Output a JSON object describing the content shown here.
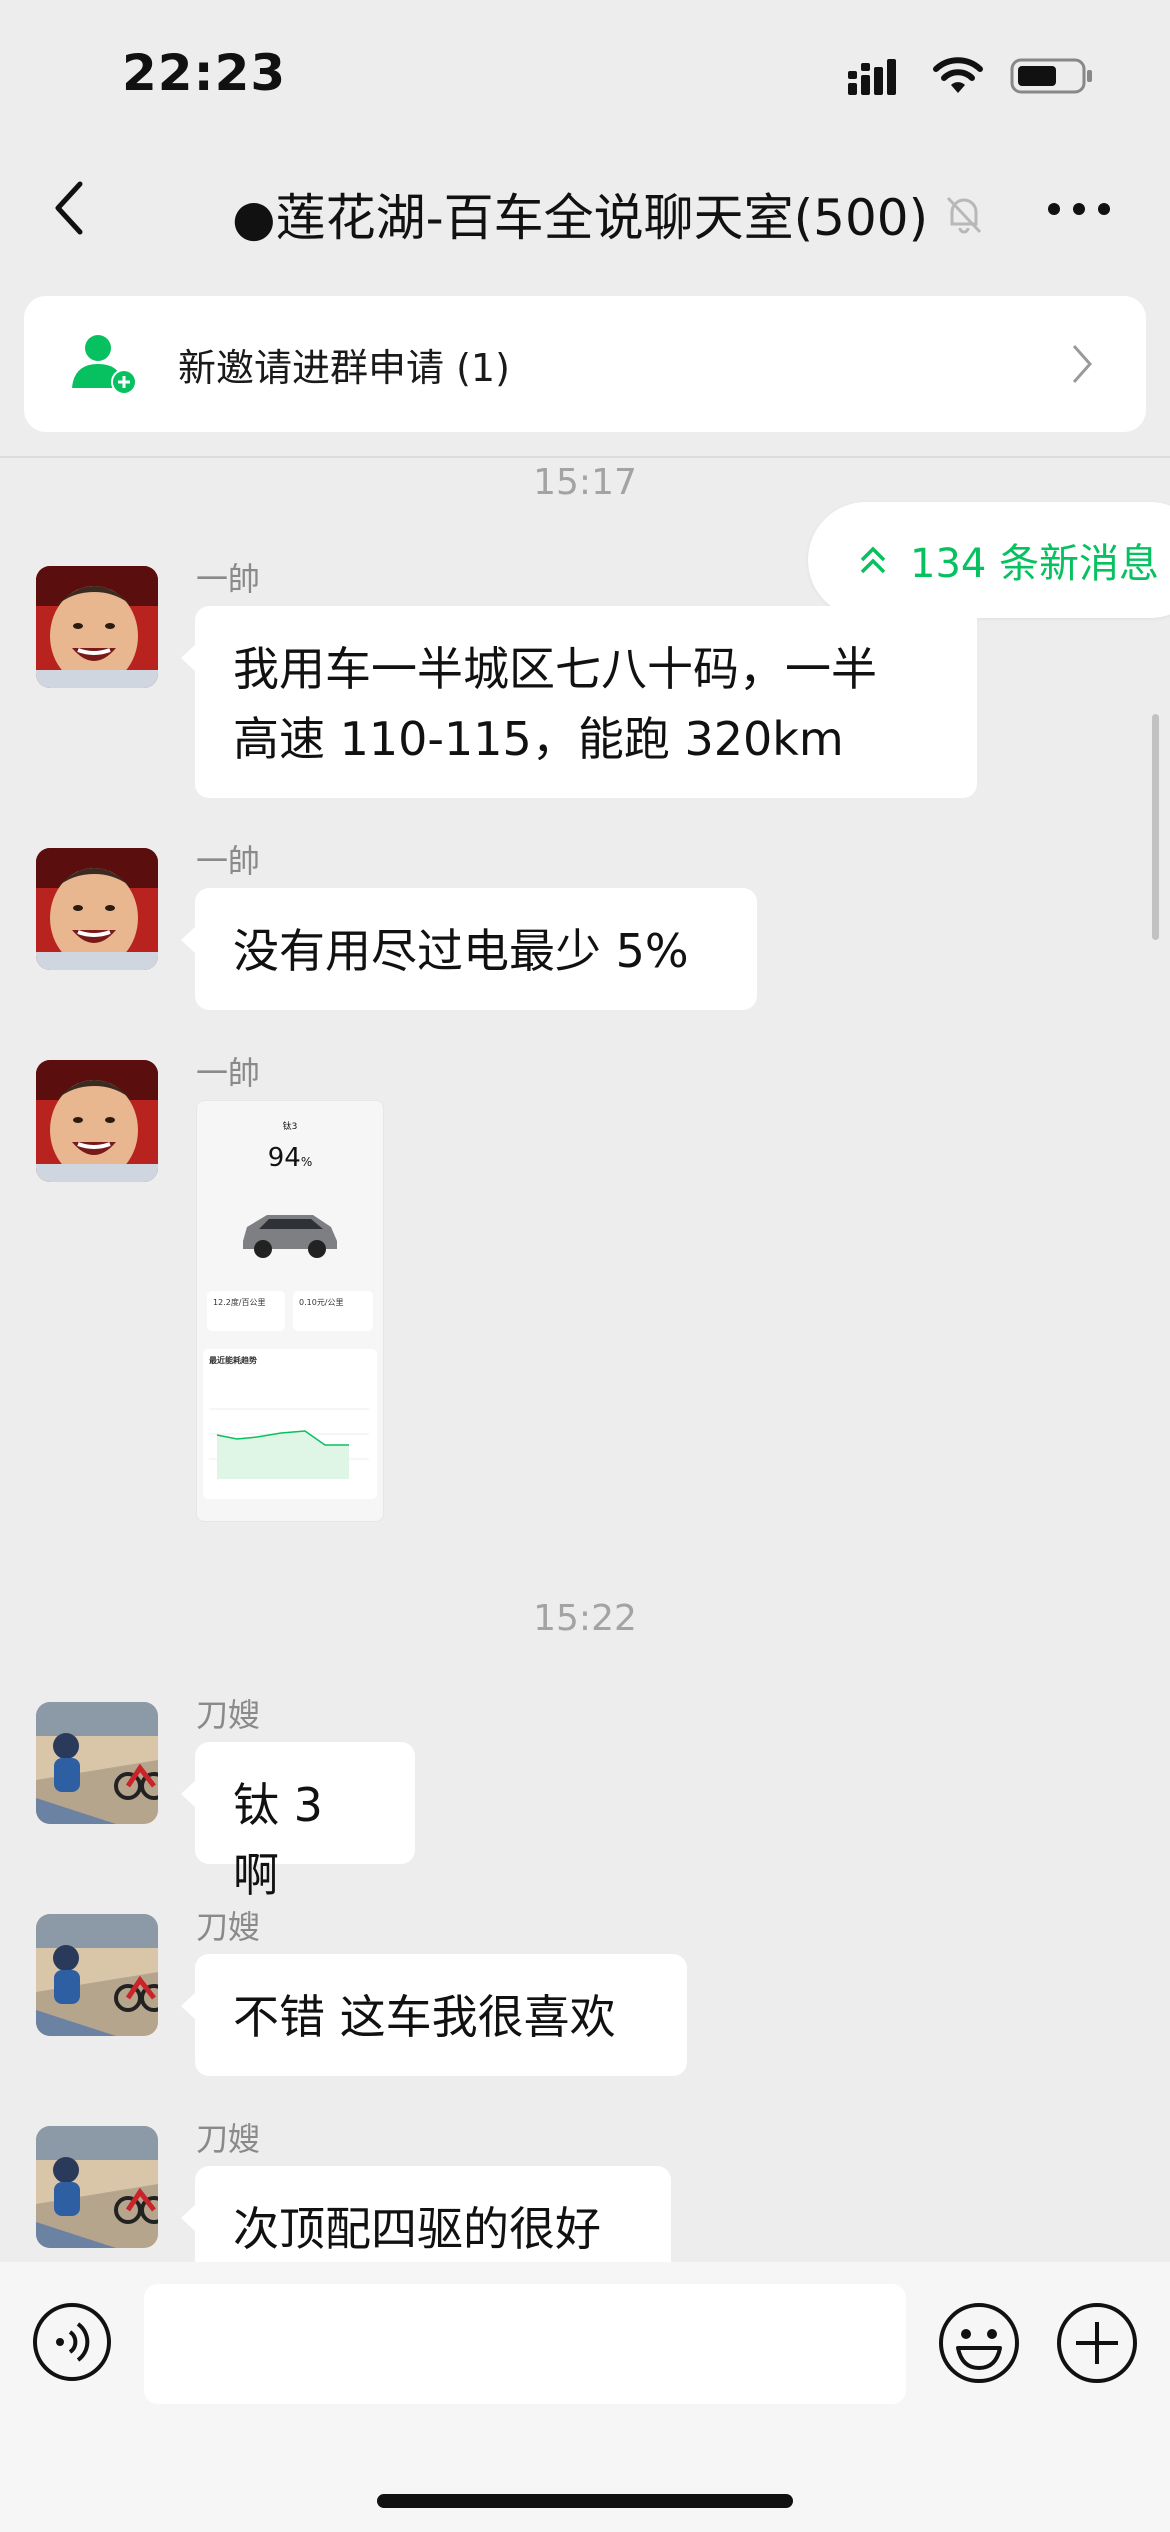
{
  "status_bar": {
    "time": "22:23"
  },
  "nav": {
    "title": "●莲花湖-百车全说聊天室(500)",
    "icons": [
      "back-icon",
      "mute-bell-icon",
      "more-icon"
    ]
  },
  "invite_banner": {
    "text": "新邀请进群申请 (1)",
    "icon": "add-member-icon"
  },
  "new_messages": {
    "label": "134 条新消息",
    "icon": "double-chevron-up-icon"
  },
  "colors": {
    "accent": "#07c160",
    "background": "#ededed",
    "bubble": "#ffffff"
  },
  "messages": [
    {
      "time": "15:17"
    },
    {
      "sender": "一帥",
      "text": "我用车一半城区七八十码，一半高速 110-115，能跑 320km",
      "line1": "我用车一半城区七八十码，一半",
      "line2": "高速 110-115，能跑 320km"
    },
    {
      "sender": "一帥",
      "text": "没有用尽过电最少 5%"
    },
    {
      "sender": "一帥",
      "image": {
        "title": "钛3",
        "battery": "94",
        "battery_unit": "%",
        "stat1": "12.2度/百公里",
        "stat2": "0.10元/公里",
        "chart_title": "最近能耗趋势"
      }
    },
    {
      "time": "15:22"
    },
    {
      "sender": "刀嫂",
      "text": "钛 3 啊"
    },
    {
      "sender": "刀嫂",
      "text": "不错 这车我很喜欢"
    },
    {
      "sender": "刀嫂",
      "text": "次顶配四驱的很好"
    }
  ]
}
